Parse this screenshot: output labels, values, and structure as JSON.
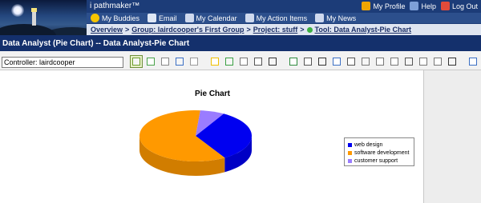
{
  "app": {
    "brand": "i pathmaker™"
  },
  "top_nav": {
    "my_profile": "My Profile",
    "help": "Help",
    "log_out": "Log Out"
  },
  "main_nav": [
    {
      "label": "My Buddies",
      "icon": "smiley-icon"
    },
    {
      "label": "Email",
      "icon": "email-icon"
    },
    {
      "label": "My Calendar",
      "icon": "calendar-icon"
    },
    {
      "label": "My Action Items",
      "icon": "action-items-icon"
    },
    {
      "label": "My News",
      "icon": "news-icon"
    }
  ],
  "breadcrumb": {
    "overview": "Overview",
    "sep": ">",
    "group": "Group: lairdcooper's First Group",
    "project": "Project: stuff",
    "tool": "Tool: Data Analyst-Pie Chart"
  },
  "title_bar": "Data Analyst (Pie Chart) -- Data Analyst-Pie Chart",
  "controller": "Controller: lairdcooper",
  "toolbar_icons": [
    "pie-chart-icon",
    "chart-data-icon",
    "print-icon",
    "copy-icon",
    "paste-icon",
    "rectangle-icon",
    "pen-icon",
    "grid-icon",
    "scissors-icon",
    "undo-icon",
    "bar-chart-icon",
    "table-icon",
    "link-icon",
    "flowchart-icon",
    "tree-icon",
    "org-chart-icon",
    "network-icon",
    "list-icon",
    "histogram-icon",
    "gear-icon",
    "settings-icon",
    "comment-icon",
    "help-icon"
  ],
  "chart_data": {
    "type": "pie",
    "title": "Pie Chart",
    "categories": [
      "web design",
      "software development",
      "customer support"
    ],
    "values": [
      33,
      60,
      7
    ],
    "colors": [
      "#0000f0",
      "#ff9900",
      "#9a7cff"
    ],
    "legend_position": "right"
  }
}
